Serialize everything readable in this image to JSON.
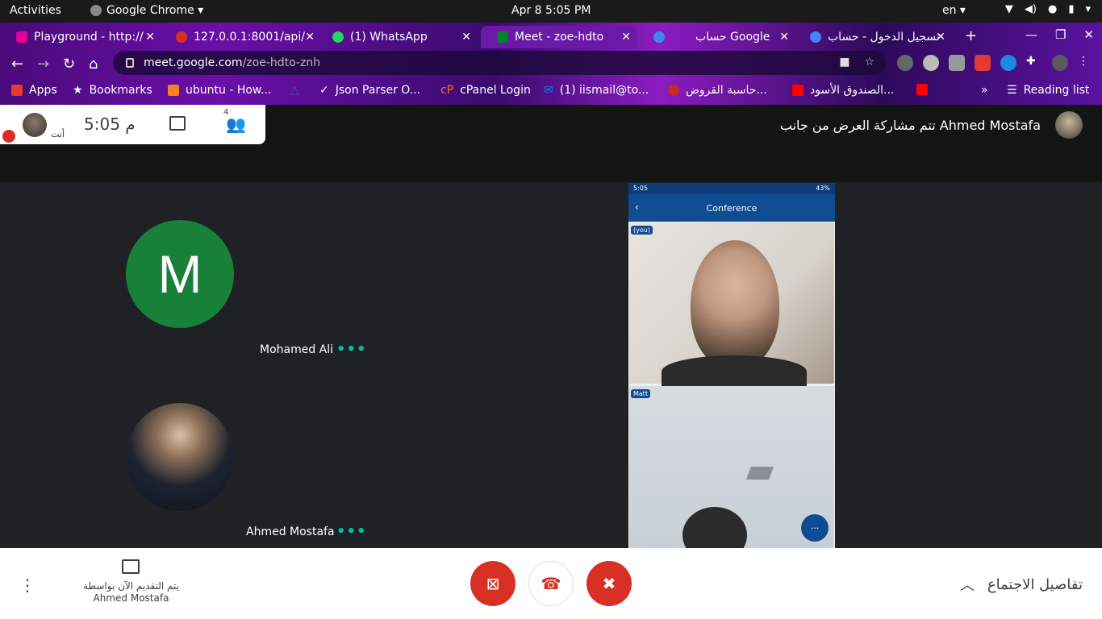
{
  "desktop": {
    "activities": "Activities",
    "app_name": "Google Chrome ▾",
    "clock": "Apr 8   5:05 PM",
    "lang": "en ▾"
  },
  "tabs": [
    {
      "label": "Playground - http://",
      "favicon_color": "#e10098"
    },
    {
      "label": "127.0.0.1:8001/api/",
      "favicon_color": "#d93025"
    },
    {
      "label": "(1) WhatsApp",
      "favicon_color": "#25d366"
    },
    {
      "label": "Meet - zoe-hdto",
      "favicon_color": "#00832d"
    },
    {
      "label": "حساب Google",
      "favicon_color": "#4285f4"
    },
    {
      "label": "تسجيل الدخول - حساب",
      "favicon_color": "#4285f4"
    }
  ],
  "omnibox": {
    "host": "meet.google.com",
    "path": "/zoe-hdto-znh"
  },
  "bookmarks": [
    {
      "label": "Apps",
      "color": "#e53935"
    },
    {
      "label": "Bookmarks",
      "color": "#ffffff"
    },
    {
      "label": "ubuntu - How...",
      "color": "#f48024"
    },
    {
      "label": "",
      "color": "#3f51b5"
    },
    {
      "label": "Json Parser O...",
      "color": "#ffffff"
    },
    {
      "label": "cPanel Login",
      "color": "#ff6c2c"
    },
    {
      "label": "(1) iismail@to...",
      "color": "#1a73e8"
    },
    {
      "label": "حاسبة القروض...",
      "color": "#c62828"
    },
    {
      "label": "الصندوق الأسود...",
      "color": "#ff0000"
    },
    {
      "label": "",
      "color": "#ff0000"
    },
    {
      "label": "»",
      "color": "transparent"
    },
    {
      "label": "Reading list",
      "color": "transparent"
    }
  ],
  "meet": {
    "self_label": "أنت",
    "time": "5:05 م",
    "participants_count": "4",
    "presenter_banner": "تتم مشاركة العرض من جانب Ahmed Mostafa",
    "participants": [
      {
        "initial": "M",
        "name": "Mohamed Ali",
        "avatar_color": "#188038"
      },
      {
        "name": "Ahmed Mostafa"
      }
    ],
    "more_dots": "•••",
    "presentation": {
      "status_time": "5:05",
      "status_right": "43%",
      "title": "Conference",
      "tag_you": "(you)",
      "tag_other": "Matt",
      "fab": "···"
    }
  },
  "controls": {
    "presenting_line1": "يتم التقديم الآن بواسطة",
    "presenting_line2": "Ahmed Mostafa",
    "meeting_details": "تفاصيل الاجتماع",
    "red": "#d93025"
  }
}
